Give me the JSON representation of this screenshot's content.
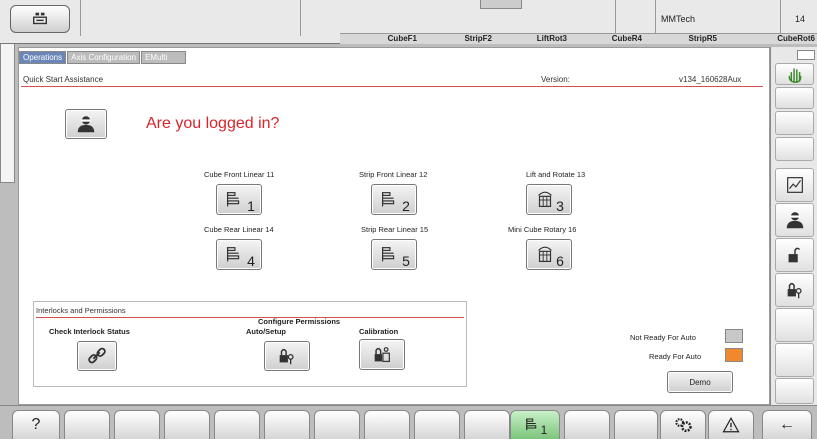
{
  "top_bar": {
    "machine_name": "MMTech",
    "unit_count": "14",
    "cells": [
      "CubeF1",
      "StripF2",
      "LiftRot3",
      "CubeR4",
      "StripR5",
      "CubeRot6"
    ]
  },
  "tabs": [
    {
      "label": "Operations"
    },
    {
      "label": "Axis Configuration"
    },
    {
      "label": "EMulti"
    }
  ],
  "quick_start": {
    "title": "Quick Start Assistance",
    "version_label": "Version:",
    "version_value": "v134_160628Aux",
    "login_question": "Are you logged in?"
  },
  "axes": [
    {
      "label": "Cube Front Linear 11",
      "number": "1"
    },
    {
      "label": "Strip Front Linear 12",
      "number": "2"
    },
    {
      "label": "Lift and Rotate 13",
      "number": "3"
    },
    {
      "label": "Cube Rear Linear 14",
      "number": "4"
    },
    {
      "label": "Strip Rear Linear 15",
      "number": "5"
    },
    {
      "label": "Mini Cube Rotary 16",
      "number": "6"
    }
  ],
  "interlocks": {
    "title": "Interlocks and Permissions",
    "check_label": "Check Interlock Status",
    "configure_label_line1": "Configure Permissions",
    "configure_label_line2": "Auto/Setup",
    "calibration_label": "Calibration"
  },
  "status": {
    "not_ready_label": "Not Ready For Auto",
    "ready_label": "Ready For Auto",
    "not_ready_color": "#c8c8c8",
    "ready_color": "#f0892e",
    "demo_label": "Demo"
  },
  "bottom_bar": {
    "help_label": "?",
    "active_axis_number": "1",
    "back_label": "←"
  },
  "icons": [
    "person-icon",
    "linear-axis-icon",
    "rotary-axis-icon",
    "link-icon",
    "lock-key-icon",
    "gears-icon",
    "warning-icon",
    "chart-icon",
    "hand-icon"
  ]
}
